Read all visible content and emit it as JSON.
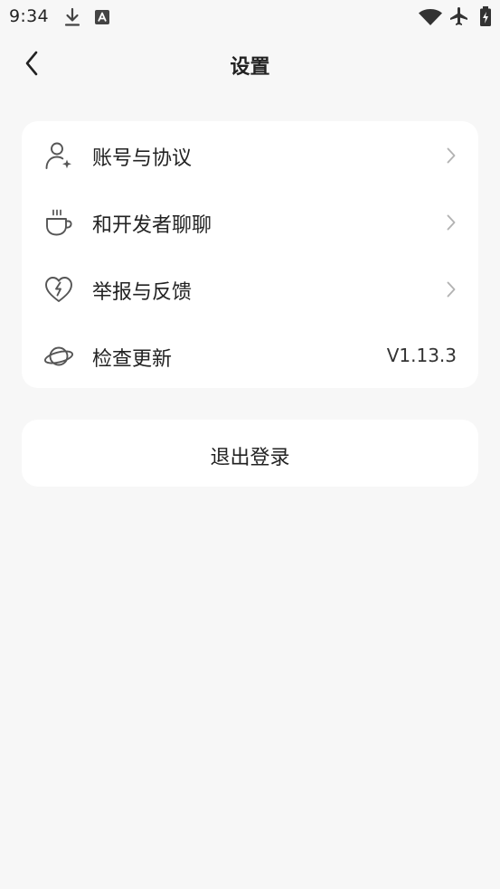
{
  "status_bar": {
    "time": "9:34",
    "icons": [
      "download-icon",
      "app-notification-icon",
      "wifi-icon",
      "airplane-icon",
      "battery-icon"
    ]
  },
  "header": {
    "back_icon": "chevron-left-icon",
    "title": "设置"
  },
  "menu": {
    "items": [
      {
        "icon": "user-star-icon",
        "label": "账号与协议",
        "has_chevron": true
      },
      {
        "icon": "coffee-cup-icon",
        "label": "和开发者聊聊",
        "has_chevron": true
      },
      {
        "icon": "broken-heart-icon",
        "label": "举报与反馈",
        "has_chevron": true
      },
      {
        "icon": "planet-icon",
        "label": "检查更新",
        "value": "V1.13.3"
      }
    ]
  },
  "logout": {
    "label": "退出登录"
  },
  "colors": {
    "background": "#f7f7f7",
    "card": "#ffffff",
    "text": "#222222",
    "icon": "#555555",
    "chevron": "#b3b3b3"
  }
}
